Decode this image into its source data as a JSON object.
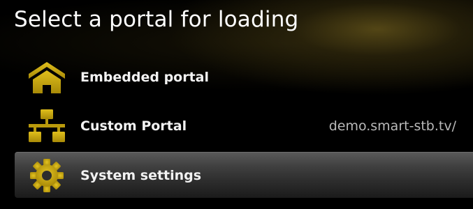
{
  "header": {
    "title": "Select a portal for loading"
  },
  "menu": {
    "items": [
      {
        "label": "Embedded portal",
        "icon": "home-icon",
        "value": "",
        "selected": false
      },
      {
        "label": "Custom Portal",
        "icon": "network-icon",
        "value": "demo.smart-stb.tv/",
        "selected": false
      },
      {
        "label": "System settings",
        "icon": "gear-icon",
        "value": "",
        "selected": true
      }
    ]
  },
  "colors": {
    "icon_gold": "#c9a70c",
    "icon_gold_dark": "#8c7306",
    "selection_bar": "#404040",
    "text": "#f2f2f2",
    "value_text": "#b9b9b9"
  }
}
